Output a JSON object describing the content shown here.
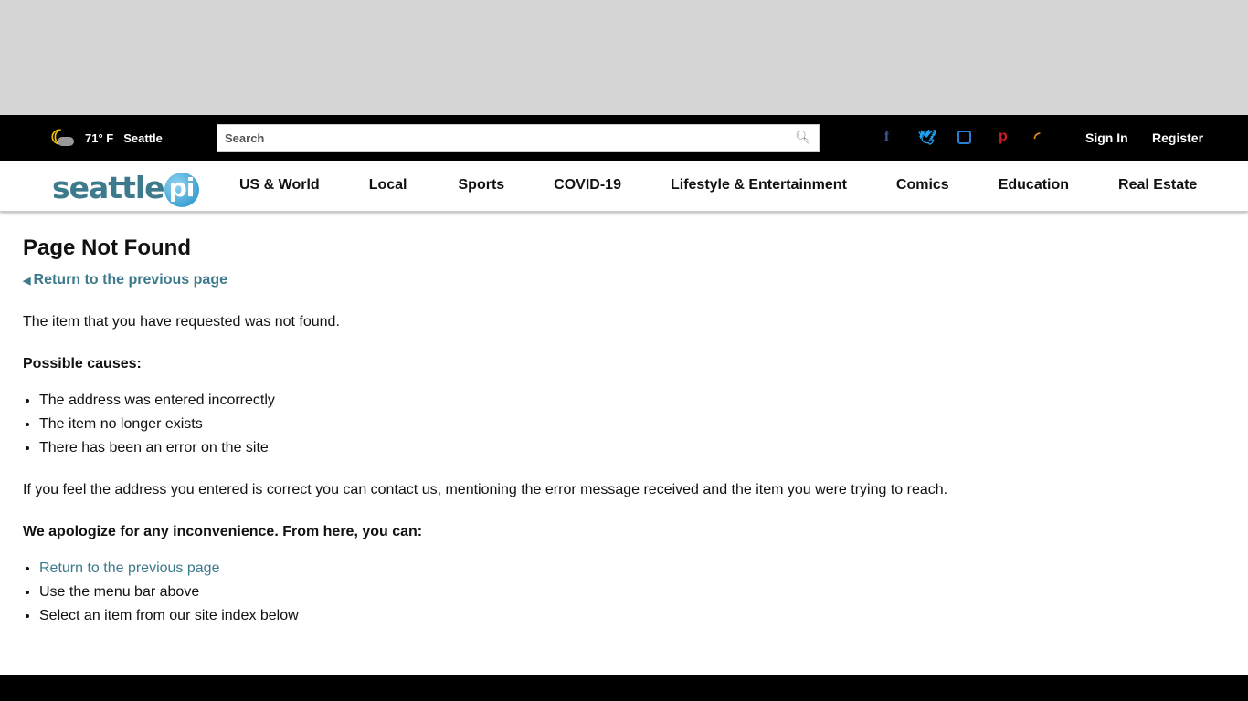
{
  "header": {
    "temperature": "71° F",
    "city": "Seattle",
    "search_placeholder": "Search",
    "sign_in": "Sign In",
    "register": "Register",
    "social": [
      {
        "icon": "facebook-icon",
        "glyph": "f",
        "color": "#3b5998"
      },
      {
        "icon": "twitter-icon",
        "glyph": "🐦",
        "color": "#1da1f2"
      },
      {
        "icon": "instagram-icon",
        "glyph": "◙",
        "color": "#2a7fd4"
      },
      {
        "icon": "pinterest-icon",
        "glyph": "p",
        "color": "#cb2027"
      },
      {
        "icon": "rss-icon",
        "glyph": "☰",
        "color": "#f7931e"
      }
    ]
  },
  "logo": {
    "text": "seattle",
    "pi": "pi"
  },
  "nav": [
    "US & World",
    "Local",
    "Sports",
    "COVID-19",
    "Lifestyle & Entertainment",
    "Comics",
    "Education",
    "Real Estate"
  ],
  "main": {
    "title": "Page Not Found",
    "back_link": "Return to the previous page",
    "intro": "The item that you have requested was not found.",
    "causes_heading": "Possible causes:",
    "causes": [
      "The address was entered incorrectly",
      "The item no longer exists",
      "There has been an error on the site"
    ],
    "contact": "If you feel the address you entered is correct you can contact us, mentioning the error message received and the item you were trying to reach.",
    "apology": "We apologize for any inconvenience. From here, you can:",
    "options": [
      "Return to the previous page",
      "Use the menu bar above",
      "Select an item from our site index below"
    ]
  }
}
